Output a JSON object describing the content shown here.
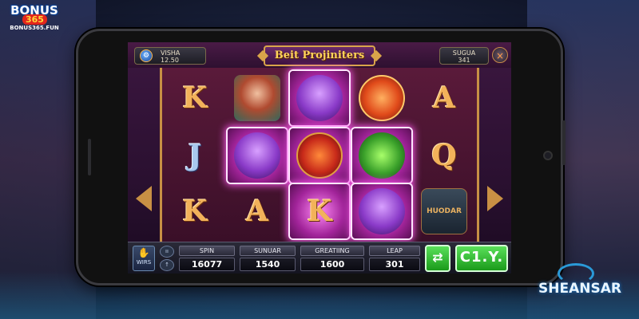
{
  "logo": {
    "line1": "BONUS",
    "line2": "365",
    "line3": "BONUS365.FUN"
  },
  "game": {
    "title": "Beit Projiniters",
    "balance_label": "VISHA",
    "balance_value": "12.50",
    "bet_label": "SUGUA",
    "bet_value": "341",
    "close_icon": "×"
  },
  "reels": [
    [
      {
        "type": "letter",
        "text": "K",
        "color": "gold",
        "win": false
      },
      {
        "type": "letter",
        "text": "J",
        "color": "blue",
        "win": false
      },
      {
        "type": "letter",
        "text": "K",
        "color": "gold",
        "win": false
      }
    ],
    [
      {
        "type": "symbol",
        "kind": "witch",
        "text": "",
        "win": false
      },
      {
        "type": "symbol",
        "kind": "cat",
        "text": "",
        "win": true
      },
      {
        "type": "letter",
        "text": "A",
        "color": "gold",
        "win": false
      }
    ],
    [
      {
        "type": "symbol",
        "kind": "cat",
        "text": "",
        "win": true
      },
      {
        "type": "symbol",
        "kind": "medal",
        "text": "",
        "win": true
      },
      {
        "type": "letter",
        "text": "K",
        "color": "gold",
        "win": true
      }
    ],
    [
      {
        "type": "symbol",
        "kind": "dragon",
        "text": "",
        "win": false
      },
      {
        "type": "symbol",
        "kind": "goblin",
        "text": "",
        "win": true
      },
      {
        "type": "symbol",
        "kind": "cat",
        "text": "",
        "win": true
      }
    ],
    [
      {
        "type": "letter",
        "text": "A",
        "color": "gold",
        "win": false
      },
      {
        "type": "letter",
        "text": "Q",
        "color": "gold",
        "win": false
      },
      {
        "type": "symbol",
        "kind": "hat",
        "text": "HUODAR",
        "win": false
      }
    ]
  ],
  "bottom": {
    "wins_label": "WIRS",
    "wins_icon": "✋",
    "stats": [
      {
        "label": "SPIN",
        "value": "16077"
      },
      {
        "label": "SUNUAR",
        "value": "1540"
      },
      {
        "label": "GREATIING",
        "value": "1600"
      },
      {
        "label": "LEAP",
        "value": "301"
      }
    ],
    "swap_label": "⇄",
    "spin_label": "C1.Y."
  },
  "watermark": {
    "text": "SHEANSAR"
  },
  "colors": {
    "accent_gold": "#d9a54a",
    "win_glow": "#ff5af0",
    "button_green": "#3ac03a"
  }
}
